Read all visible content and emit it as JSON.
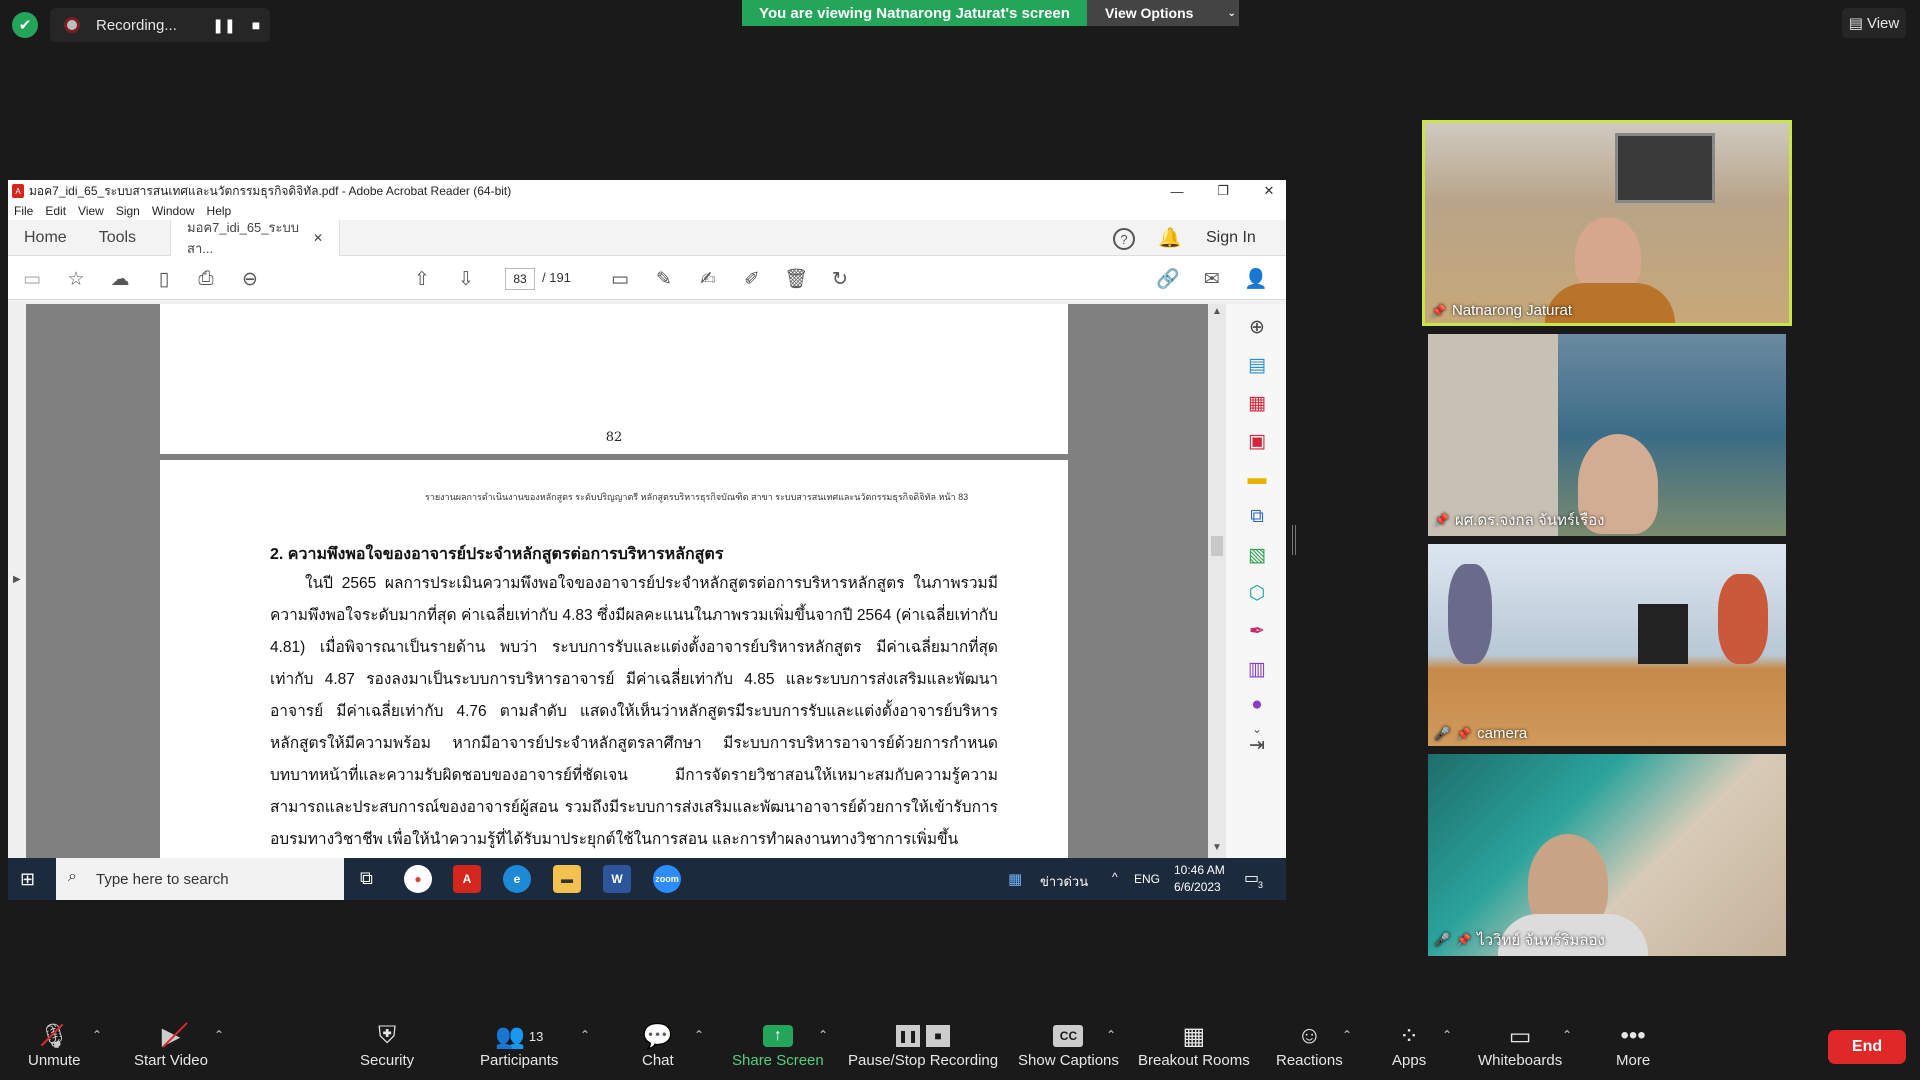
{
  "top": {
    "recording_label": "Recording...",
    "viewing_banner": "You are viewing Natnarong Jaturat's screen",
    "view_options": "View Options",
    "view_label": "View"
  },
  "acrobat": {
    "title": "มอค7_idi_65_ระบบสารสนเทศและนวัตกรรมธุรกิจดิจิทัล.pdf - Adobe Acrobat Reader (64-bit)",
    "menu": [
      "File",
      "Edit",
      "View",
      "Sign",
      "Window",
      "Help"
    ],
    "tab_home": "Home",
    "tab_tools": "Tools",
    "doc_tab": "มอค7_idi_65_ระบบสา...",
    "sign_in": "Sign In",
    "page_current": "83",
    "page_total": "/ 191",
    "page_number_prev": "82",
    "page_header": "รายงานผลการดำเนินงานของหลักสูตร ระดับปริญญาตรี หลักสูตรบริหารธุรกิจบัณฑิต สาขา ระบบสารสนเทศและนวัตกรรมธุรกิจดิจิทัล หน้า 83",
    "heading": "2. ความพึงพอใจของอาจารย์ประจำหลักสูตรต่อการบริหารหลักสูตร",
    "paragraph": "ในปี 2565 ผลการประเมินความพึงพอใจของอาจารย์ประจำหลักสูตรต่อการบริหารหลักสูตร ในภาพรวมมีความพึงพอใจระดับมากที่สุด ค่าเฉลี่ยเท่ากับ 4.83 ซึ่งมีผลคะแนนในภาพรวมเพิ่มขึ้นจากปี 2564 (ค่าเฉลี่ยเท่ากับ 4.81) เมื่อพิจารณาเป็นรายด้าน พบว่า ระบบการรับและแต่งตั้งอาจารย์บริหารหลักสูตร มีค่าเฉลี่ยมากที่สุดเท่ากับ 4.87 รองลงมาเป็นระบบการบริหารอาจารย์ มีค่าเฉลี่ยเท่ากับ 4.85 และระบบการส่งเสริมและพัฒนาอาจารย์ มีค่าเฉลี่ยเท่ากับ 4.76 ตามลำดับ แสดงให้เห็นว่าหลักสูตรมีระบบการรับและแต่งตั้งอาจารย์บริหารหลักสูตรให้มีความพร้อม หากมีอาจารย์ประจำหลักสูตรลาศึกษา มีระบบการบริหารอาจารย์ด้วยการกำหนดบทบาทหน้าที่และความรับผิดชอบของอาจารย์ที่ชัดเจน มีการจัดรายวิชาสอนให้เหมาะสมกับความรู้ความสามารถและประสบการณ์ของอาจารย์ผู้สอน รวมถึงมีระบบการส่งเสริมและพัฒนาอาจารย์ด้วยการให้เข้ารับการอบรมทางวิชาชีพ เพื่อให้นำความรู้ที่ได้รับมาประยุกต์ใช้ในการสอน และการทำผลงานทางวิชาการเพิ่มขึ้น"
  },
  "taskbar": {
    "search_placeholder": "Type here to search",
    "news": "ข่าวด่วน",
    "lang": "ENG",
    "time": "10:46 AM",
    "date": "6/6/2023",
    "notif_count": "3"
  },
  "participants": [
    {
      "name": "Natnarong Jaturat",
      "muted": false,
      "active": true
    },
    {
      "name": "ผศ.ดร.จงกล จันทร์เรือง",
      "muted": false,
      "active": false
    },
    {
      "name": "camera",
      "muted": true,
      "active": false
    },
    {
      "name": "ไววิทย์ จันทร์ริมลอง",
      "muted": true,
      "active": false
    }
  ],
  "bottom": {
    "unmute": "Unmute",
    "start_video": "Start Video",
    "security": "Security",
    "participants": "Participants",
    "participant_count": "13",
    "chat": "Chat",
    "share_screen": "Share Screen",
    "pause_stop": "Pause/Stop Recording",
    "captions": "Show Captions",
    "breakout": "Breakout Rooms",
    "reactions": "Reactions",
    "apps": "Apps",
    "whiteboards": "Whiteboards",
    "more": "More",
    "end": "End"
  },
  "colors": {
    "zoom_green": "#23a55a",
    "end_red": "#e02828",
    "active_speaker": "#c8e64a"
  }
}
